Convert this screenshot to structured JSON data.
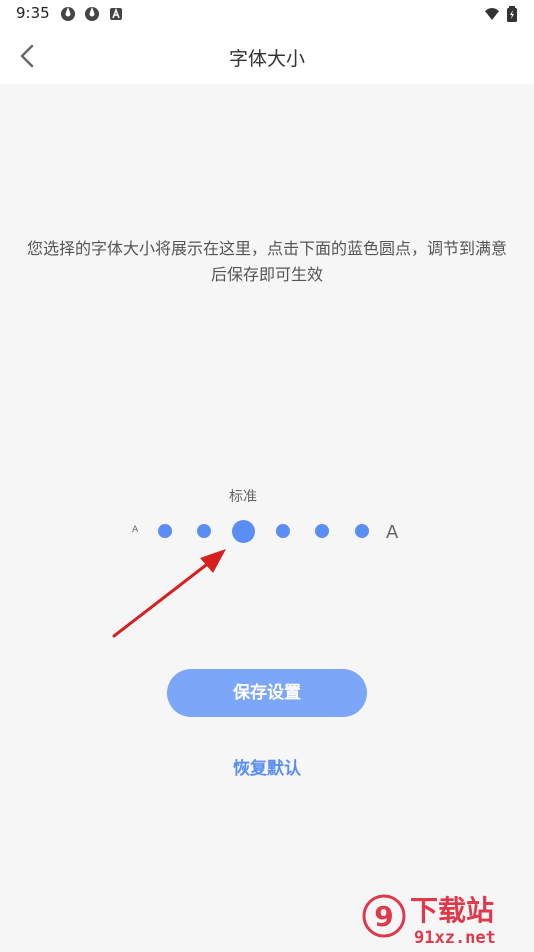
{
  "status_bar": {
    "time": "9:35",
    "icons": [
      "app-notification-icon",
      "app-notification-icon",
      "a-notification-icon",
      "wifi-icon",
      "battery-icon"
    ]
  },
  "header": {
    "title": "字体大小",
    "back_icon": "chevron-left-icon"
  },
  "preview": {
    "text": "您选择的字体大小将展示在这里，点击下面的蓝色圆点，调节到满意后保存即可生效"
  },
  "font_size_selector": {
    "current_label": "标准",
    "small_marker": "A",
    "large_marker": "A",
    "level_count": 6,
    "selected_level": 3,
    "accent_color": "#5b8ef5"
  },
  "actions": {
    "save_label": "保存设置",
    "reset_label": "恢复默认"
  },
  "watermark": {
    "brand": "下载站",
    "site": "91xz.net",
    "logo_mark": "9"
  },
  "colors": {
    "accent": "#5b8ef5",
    "button": "#7ca6f7",
    "annotation_arrow": "#d62020",
    "watermark": "#e0394b"
  }
}
